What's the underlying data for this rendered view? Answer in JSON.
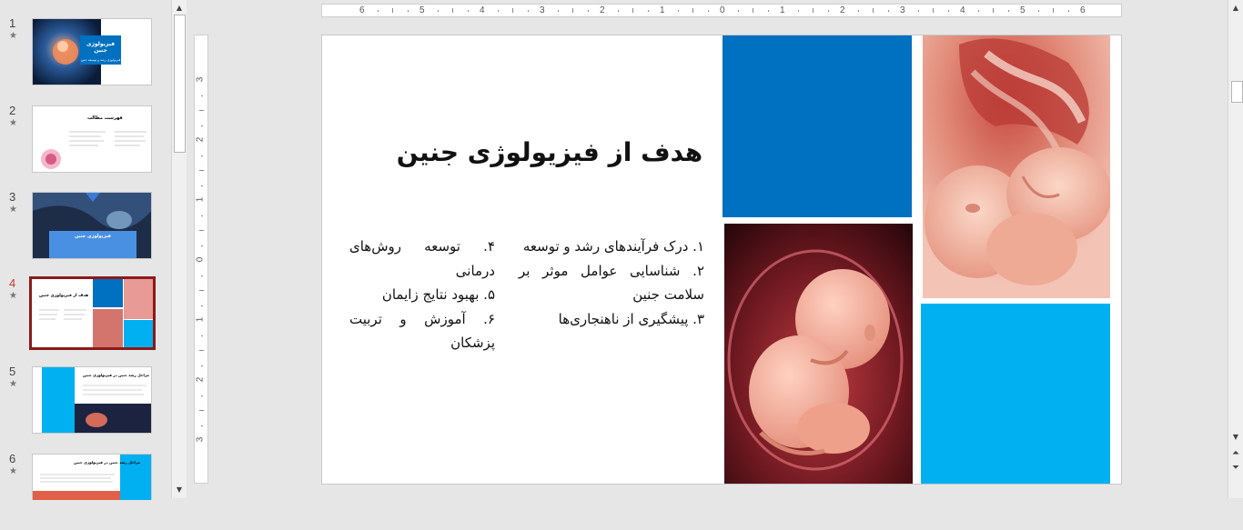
{
  "thumbnails": [
    {
      "num": "1",
      "title": "فیزیولوژی جنین",
      "subtitle": "فیزیولوژی رشد و توسعه جنین"
    },
    {
      "num": "2",
      "title": "فهرست مطالب"
    },
    {
      "num": "3",
      "title": "فیزیولوژی جنین"
    },
    {
      "num": "4",
      "title": "هدف از فیزیولوژی جنین"
    },
    {
      "num": "5",
      "title": "مراحل رشد جنین در فیزیولوژی جنین"
    },
    {
      "num": "6",
      "title": "مراحل رشد جنین در فیزیولوژی جنین"
    }
  ],
  "ruler": {
    "h_labels": [
      "6",
      "5",
      "4",
      "3",
      "2",
      "1",
      "0",
      "1",
      "2",
      "3",
      "4",
      "5",
      "6"
    ],
    "v_labels": [
      "3",
      "2",
      "1",
      "0",
      "1",
      "2",
      "3"
    ]
  },
  "slide": {
    "title": "هدف از فیزیولوژی جنین",
    "col_right": [
      "۱. درک فرآیندهای رشد و توسعه",
      "۲. شناسایی عوامل موثر بر سلامت جنین",
      "۳. پیشگیری از ناهنجاری‌ها"
    ],
    "col_left": [
      "۴. توسعه روش‌های درمانی",
      "۵. بهبود نتایج زایمان",
      "۶. آموزش و تربیت پزشکان"
    ]
  },
  "colors": {
    "dark_blue": "#0070c0",
    "light_blue": "#00b0f0",
    "selection": "#8b1a1a"
  }
}
